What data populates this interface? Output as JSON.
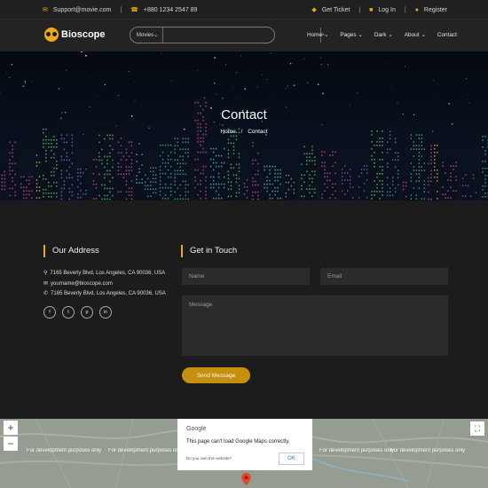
{
  "topbar": {
    "email": "Support@movie.com",
    "phone": "+880 1234 2547 89",
    "get_ticket": "Get Ticket",
    "login": "Log In",
    "register": "Register"
  },
  "header": {
    "logo": "Bioscope",
    "search_category": "Movies",
    "nav": [
      "Home",
      "Pages",
      "Dark",
      "About",
      "Contact"
    ]
  },
  "hero": {
    "title": "Contact",
    "breadcrumb_home": "Home",
    "breadcrumb_sep": "/",
    "breadcrumb_current": "Contact"
  },
  "address": {
    "heading": "Our Address",
    "line1": "7165 Beverly Blvd, Los Angeles, CA 90036, USA",
    "email": "yourname@bioscope.com",
    "line2": "7165 Beverly Blvd, Los Angeles, CA 90036, USA",
    "social": [
      "f",
      "t",
      "p",
      "in"
    ]
  },
  "form": {
    "heading": "Get in Touch",
    "name_placeholder": "Name",
    "email_placeholder": "Email",
    "message_placeholder": "Message",
    "submit": "Send Message"
  },
  "map": {
    "dialog_title": "Google",
    "dialog_message": "This page can't load Google Maps correctly.",
    "dialog_own": "Do you own this website?",
    "dialog_ok": "OK",
    "watermark": "For development purposes only",
    "zoom_in": "+",
    "zoom_out": "−"
  },
  "colors": {
    "accent": "#f0a818",
    "button": "#c4900e",
    "background": "#1c1c1c",
    "header": "#232323"
  }
}
